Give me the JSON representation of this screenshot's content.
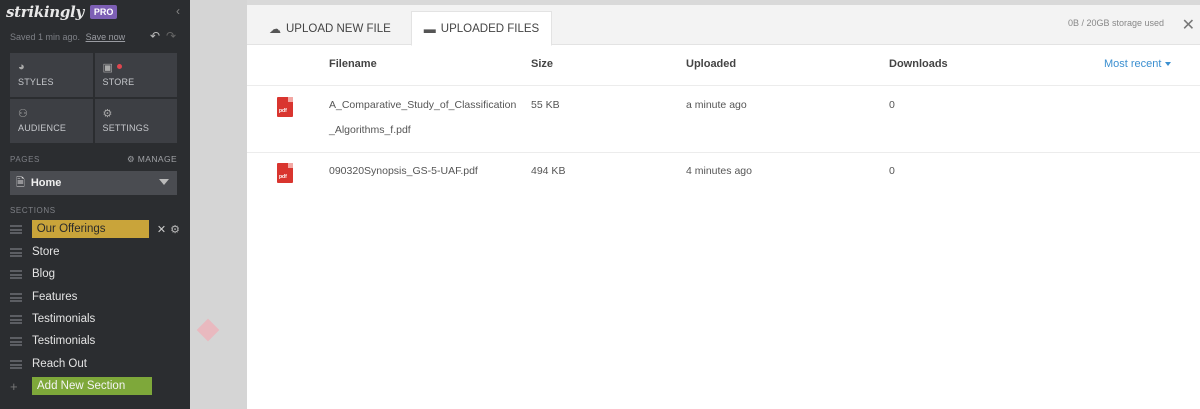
{
  "sidebar": {
    "logo": "strikingly",
    "badge": "PRO",
    "saved_text": "Saved 1 min ago.",
    "save_now": "Save now",
    "tiles": [
      {
        "label": "STYLES",
        "icon": "palette-icon"
      },
      {
        "label": "STORE",
        "icon": "store-bag-icon"
      },
      {
        "label": "AUDIENCE",
        "icon": "people-icon"
      },
      {
        "label": "SETTINGS",
        "icon": "gear-icon"
      }
    ],
    "pages_label": "PAGES",
    "manage_label": "MANAGE",
    "current_page": "Home",
    "sections_label": "SECTIONS",
    "sections": [
      "Our Offerings",
      "Store",
      "Blog",
      "Features",
      "Testimonials",
      "Testimonials",
      "Reach Out"
    ],
    "add_section": "Add New Section",
    "colors": {
      "active_section": "#c9a43a",
      "add_section": "#7ea83a",
      "badge": "#7d5fb5"
    }
  },
  "modal": {
    "tabs": [
      {
        "label": "UPLOAD NEW FILE",
        "icon": "cloud-upload-icon"
      },
      {
        "label": "UPLOADED FILES",
        "icon": "folder-icon"
      }
    ],
    "storage": "0B / 20GB storage used",
    "columns": {
      "filename": "Filename",
      "size": "Size",
      "uploaded": "Uploaded",
      "downloads": "Downloads"
    },
    "sort_label": "Most recent",
    "files": [
      {
        "name": "A_Comparative_Study_of_Classification_Algorithms_f.pdf",
        "size": "55 KB",
        "uploaded": "a minute ago",
        "downloads": "0",
        "icon_text": "pdf"
      },
      {
        "name": "090320Synopsis_GS-5-UAF.pdf",
        "size": "494 KB",
        "uploaded": "4 minutes ago",
        "downloads": "0",
        "icon_text": "pdf"
      }
    ],
    "colors": {
      "link": "#3b8fd0",
      "pdf": "#d9352f"
    }
  }
}
